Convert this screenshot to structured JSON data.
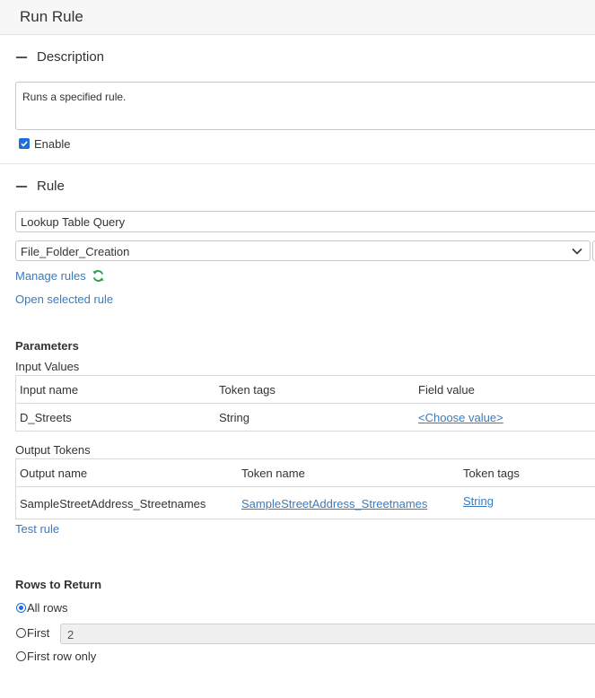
{
  "window": {
    "title": "Run Rule"
  },
  "description": {
    "heading": "Description",
    "text": "Runs a specified rule.",
    "enable_label": "Enable",
    "enabled": true
  },
  "rule": {
    "heading": "Rule",
    "rule_type": "Lookup Table Query",
    "selected_rule": "File_Folder_Creation",
    "manage_rules_label": "Manage rules",
    "open_selected_label": "Open selected rule"
  },
  "parameters": {
    "heading": "Parameters",
    "input_values": {
      "label": "Input Values",
      "columns": [
        "Input name",
        "Token tags",
        "Field value"
      ],
      "rows": [
        {
          "name": "D_Streets",
          "tags": "String",
          "value": "<Choose value>"
        }
      ]
    },
    "output_tokens": {
      "label": "Output Tokens",
      "columns": [
        "Output name",
        "Token name",
        "Token tags"
      ],
      "rows": [
        {
          "name": "SampleStreetAddress_Streetnames",
          "token": "SampleStreetAddress_Streetnames",
          "tags": "String"
        }
      ]
    },
    "test_rule_label": "Test rule"
  },
  "rows_to_return": {
    "heading": "Rows to Return",
    "options": [
      "All rows",
      "First",
      "First row only"
    ],
    "selected": "All rows",
    "first_count": "2"
  },
  "colors": {
    "link": "#3a7bbf",
    "accent": "#1e6fd9",
    "refresh": "#2ea043"
  },
  "icons": [
    "collapse-icon",
    "checkmark-icon",
    "chevron-down-icon",
    "refresh-icon"
  ]
}
